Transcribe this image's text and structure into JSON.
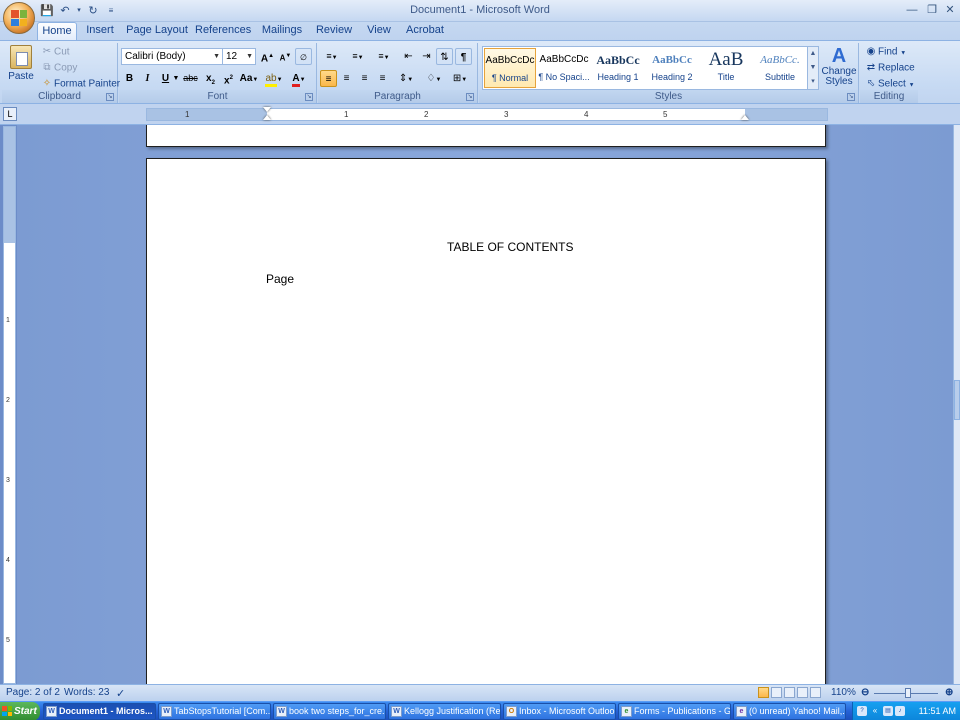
{
  "window": {
    "title": "Document1 - Microsoft Word",
    "qat_icons": [
      "save-icon",
      "undo-icon",
      "redo-icon",
      "customize-icon"
    ]
  },
  "tabs": [
    "Home",
    "Insert",
    "Page Layout",
    "References",
    "Mailings",
    "Review",
    "View",
    "Acrobat"
  ],
  "active_tab": "Home",
  "ribbon": {
    "clipboard": {
      "label": "Clipboard",
      "paste": "Paste",
      "cut": "Cut",
      "copy": "Copy",
      "format_painter": "Format Painter"
    },
    "font": {
      "label": "Font",
      "family": "Calibri (Body)",
      "size": "12"
    },
    "paragraph": {
      "label": "Paragraph"
    },
    "styles": {
      "label": "Styles",
      "tiles": [
        {
          "preview": "AaBbCcDc",
          "name": "¶ Normal"
        },
        {
          "preview": "AaBbCcDc",
          "name": "¶ No Spaci..."
        },
        {
          "preview": "AaBbCc",
          "name": "Heading 1"
        },
        {
          "preview": "AaBbCc",
          "name": "Heading 2"
        },
        {
          "preview": "AaB",
          "name": "Title"
        },
        {
          "preview": "AaBbCc.",
          "name": "Subtitle"
        }
      ],
      "change_styles": "Change Styles"
    },
    "editing": {
      "label": "Editing",
      "find": "Find",
      "replace": "Replace",
      "select": "Select"
    }
  },
  "ruler": {
    "numbers": [
      "1",
      "1",
      "2",
      "3",
      "4",
      "5"
    ]
  },
  "vruler": {
    "numbers": [
      "1",
      "2",
      "3",
      "4",
      "5"
    ]
  },
  "document": {
    "heading": "TABLE OF CONTENTS",
    "page_label": "Page"
  },
  "status": {
    "page": "Page: 2 of 2",
    "words": "Words: 23",
    "zoom": "110%"
  },
  "taskbar": {
    "start": "Start",
    "tasks": [
      "Document1 - Micros...",
      "TabStopsTutorial [Com...",
      "book two steps_for_cre...",
      "Kellogg Justification (Re...",
      "Inbox - Microsoft Outlook",
      "Forms - Publications - G...",
      "(0 unread) Yahoo! Mail,..."
    ],
    "clock": "11:51 AM"
  }
}
